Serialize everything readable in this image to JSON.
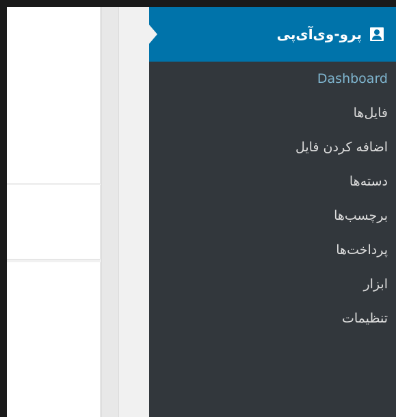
{
  "menu": {
    "title": "پرو-وی‌آی‌پی",
    "icon": "user-icon",
    "items": [
      {
        "label": "Dashboard",
        "current": true
      },
      {
        "label": "فایل‌ها"
      },
      {
        "label": "اضافه کردن فایل"
      },
      {
        "label": "دسته‌ها"
      },
      {
        "label": "برچسب‌ها"
      },
      {
        "label": "پرداخت‌ها"
      },
      {
        "label": "ابزار"
      },
      {
        "label": "تنظیمات"
      }
    ]
  },
  "colors": {
    "sidebar_bg": "#32373c",
    "active_bg": "#0073aa",
    "current_link": "#7fb5cf",
    "link": "#dddddd"
  }
}
